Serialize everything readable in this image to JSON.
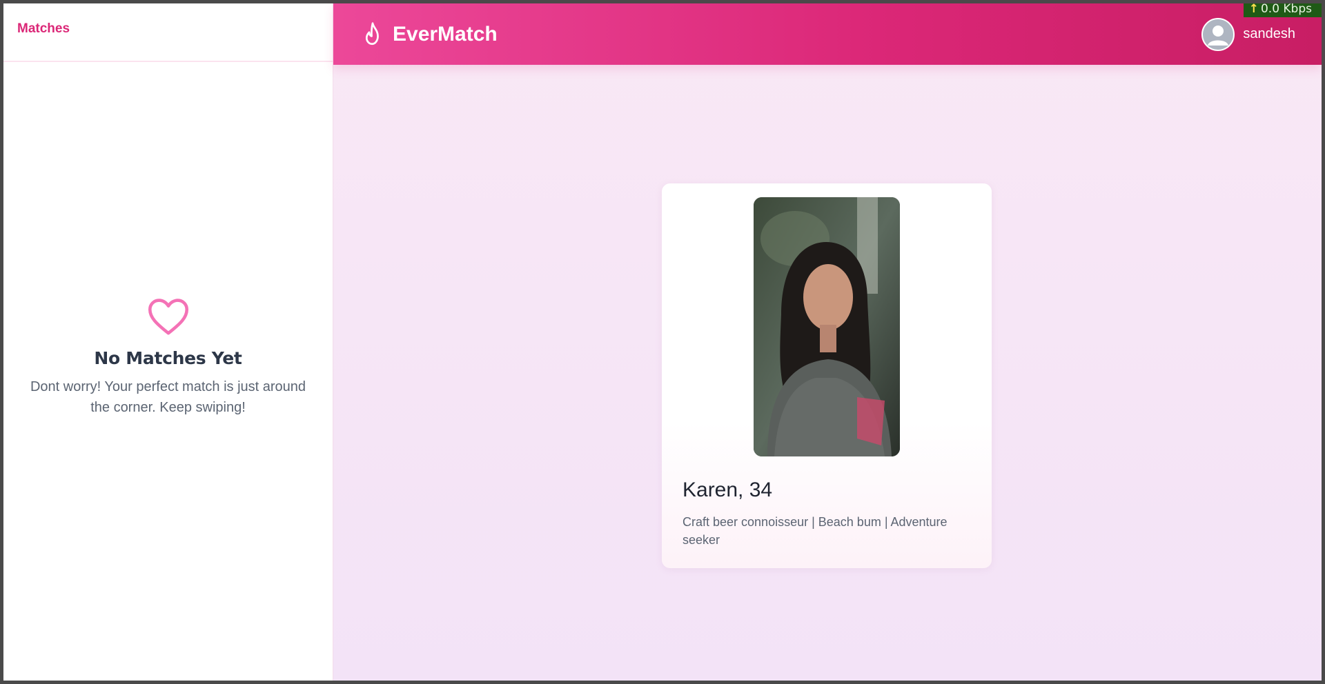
{
  "sidebar": {
    "title": "Matches",
    "empty_state": {
      "icon": "heart-icon",
      "title": "No Matches Yet",
      "text": "Dont worry! Your perfect match is just around the corner. Keep swiping!"
    }
  },
  "header": {
    "brand": "EverMatch",
    "brand_icon": "flame-icon",
    "user": {
      "name": "sandesh",
      "avatar_icon": "user-avatar-icon"
    }
  },
  "profile_card": {
    "name_age": "Karen, 34",
    "bio": "Craft beer connoisseur | Beach bum | Adventure seeker",
    "photo": "profile-photo"
  },
  "network_indicator": {
    "arrow": "↑",
    "text": "0.0 Kbps"
  },
  "colors": {
    "accent": "#db2777",
    "header_start": "#ec4899",
    "header_end": "#c81e64",
    "background": "#f6e6f6"
  }
}
